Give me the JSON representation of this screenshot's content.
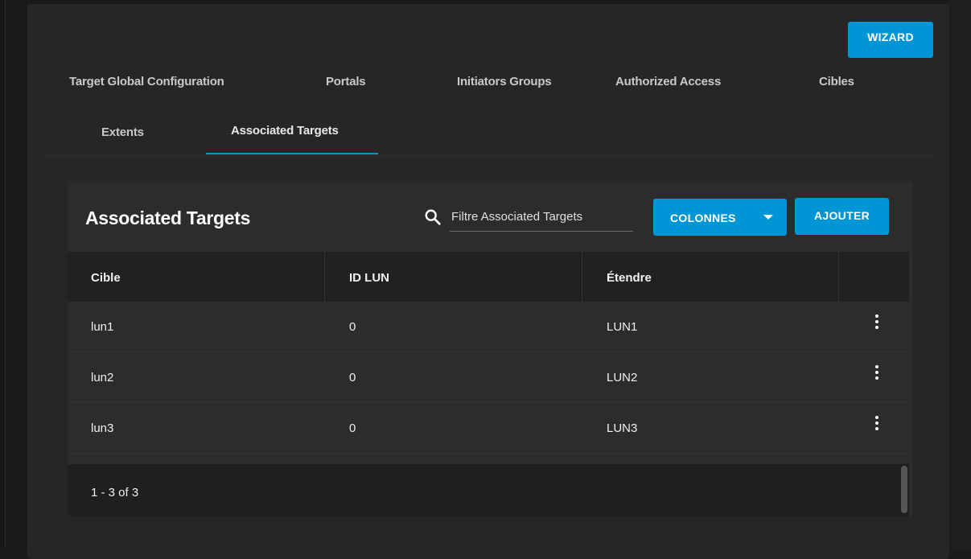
{
  "toolbar": {
    "wizard_label": "WIZARD"
  },
  "tabs": [
    {
      "label": "Target Global Configuration",
      "active": false
    },
    {
      "label": "Portals",
      "active": false
    },
    {
      "label": "Initiators Groups",
      "active": false
    },
    {
      "label": "Authorized Access",
      "active": false
    },
    {
      "label": "Cibles",
      "active": false
    },
    {
      "label": "Extents",
      "active": false
    },
    {
      "label": "Associated Targets",
      "active": true
    }
  ],
  "card": {
    "title": "Associated Targets",
    "search": {
      "placeholder": "Filtre Associated Targets",
      "value": ""
    },
    "columns_button": "COLONNES",
    "add_button": "AJOUTER",
    "table": {
      "headers": [
        "Cible",
        "ID LUN",
        "Étendre"
      ],
      "rows": [
        {
          "cible": "lun1",
          "id_lun": "0",
          "etendre": "LUN1"
        },
        {
          "cible": "lun2",
          "id_lun": "0",
          "etendre": "LUN2"
        },
        {
          "cible": "lun3",
          "id_lun": "0",
          "etendre": "LUN3"
        }
      ]
    },
    "pagination": "1 - 3 of 3"
  },
  "icons": {
    "search": "search-icon",
    "caret": "caret-down-icon",
    "row_menu": "more-vertical-icon"
  },
  "colors": {
    "accent": "#0095d5",
    "background": "#1b1b1b",
    "card": "#2c2c2c"
  }
}
